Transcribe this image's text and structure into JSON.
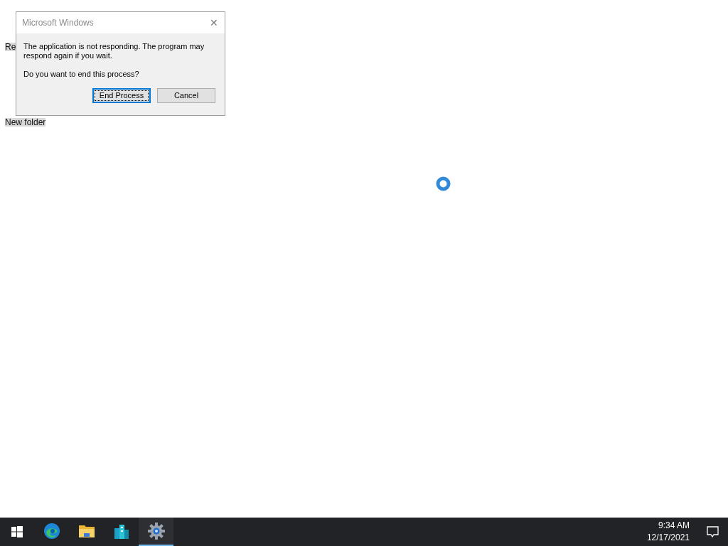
{
  "desktop": {
    "icons": [
      {
        "label": "Re"
      },
      {
        "label": "New folder"
      }
    ]
  },
  "dialog": {
    "title": "Microsoft Windows",
    "close": "✕",
    "message": "The application is not responding. The program may respond again if you wait.",
    "question": "Do you want to end this process?",
    "buttons": [
      {
        "label": "End Process",
        "selected": true
      },
      {
        "label": "Cancel",
        "selected": false
      }
    ]
  },
  "taskbar": {
    "apps": [
      {
        "kind": "edge",
        "selected": false
      },
      {
        "kind": "folder",
        "selected": false
      },
      {
        "kind": "buildings",
        "selected": false
      },
      {
        "kind": "gear",
        "selected": true
      }
    ],
    "time": "9:34 AM",
    "date": "12/17/2021"
  }
}
